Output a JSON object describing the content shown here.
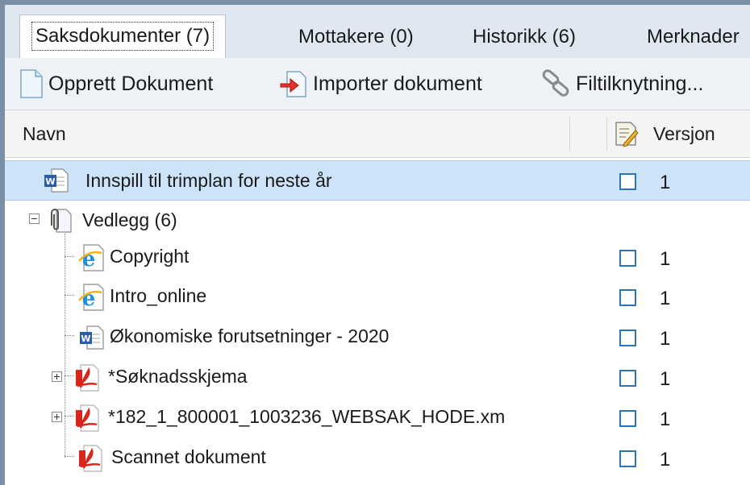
{
  "tabs": [
    {
      "label": "Saksdokumenter (7)",
      "active": true
    },
    {
      "label": "Mottakere (0)"
    },
    {
      "label": "Historikk (6)"
    },
    {
      "label": "Merknader"
    }
  ],
  "toolbar": {
    "create_label": "Opprett Dokument",
    "import_label": "Importer dokument",
    "link_label": "Filtilknytning..."
  },
  "columns": {
    "name": "Navn",
    "version": "Versjon"
  },
  "rows": [
    {
      "name": "Innspill til trimplan for neste år",
      "version": "1",
      "icon": "word-doc-icon",
      "selected": true
    },
    {
      "name": "Vedlegg (6)",
      "icon": "attachment-folder-icon"
    },
    {
      "name": "Copyright",
      "version": "1",
      "icon": "internet-explorer-icon"
    },
    {
      "name": "Intro_online",
      "version": "1",
      "icon": "internet-explorer-icon"
    },
    {
      "name": "Økonomiske forutsetninger - 2020",
      "version": "1",
      "icon": "word-doc-icon"
    },
    {
      "name": "*Søknadsskjema",
      "version": "1",
      "icon": "pdf-icon"
    },
    {
      "name": "*182_1_800001_1003236_WEBSAK_HODE.xm",
      "version": "1",
      "icon": "pdf-icon"
    },
    {
      "name": "Scannet dokument",
      "version": "1",
      "icon": "pdf-icon"
    }
  ],
  "colors": {
    "accent": "#2d73b8",
    "selection": "#cde3f8",
    "pdf": "#d9261c"
  }
}
